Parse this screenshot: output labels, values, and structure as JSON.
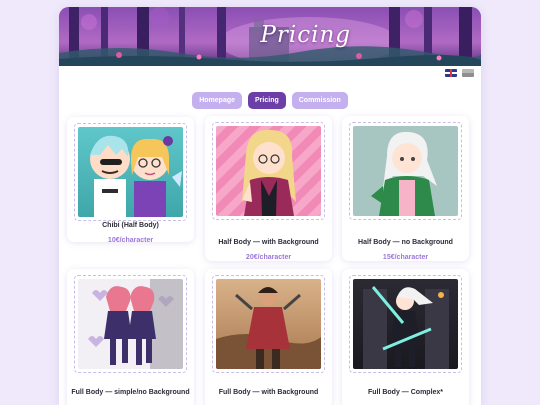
{
  "header": {
    "title": "Pricing"
  },
  "languages": [
    {
      "icon": "uk-flag-icon"
    },
    {
      "icon": "grey-flag-icon"
    }
  ],
  "nav": {
    "items": [
      {
        "label": "Homepage",
        "active": false
      },
      {
        "label": "Pricing",
        "active": true
      },
      {
        "label": "Commission",
        "active": false
      }
    ]
  },
  "cards": [
    {
      "title": "Chibi (Half Body)",
      "price": "10€/character"
    },
    {
      "title": "Half Body — with Background",
      "price": "20€/character"
    },
    {
      "title": "Half Body — no Background",
      "price": "15€/character"
    },
    {
      "title": "Full Body — simple/no Background",
      "price": ""
    },
    {
      "title": "Full Body — with Background",
      "price": ""
    },
    {
      "title": "Full Body — Complex*",
      "price": ""
    }
  ],
  "colors": {
    "accent": "#6b3ea8",
    "nav_inactive": "#c4b0ee",
    "price": "#9a78d8",
    "background": "#efe9fb"
  }
}
